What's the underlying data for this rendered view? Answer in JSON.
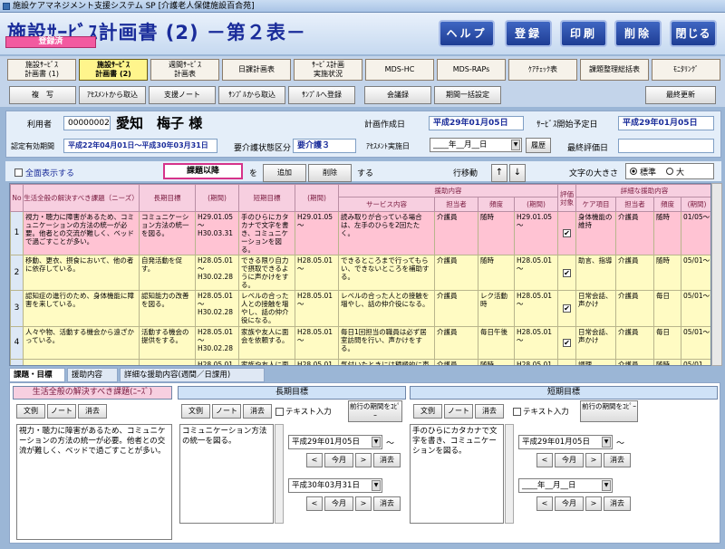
{
  "window": {
    "title": "施設ケアマネジメント支援システム SP [介護老人保健施設百合苑]"
  },
  "header": {
    "title": "施設ｻｰﾋﾞｽ計画書 (2) －第２表－",
    "status_badge": "登録済",
    "buttons": [
      "ヘルプ",
      "登録",
      "印刷",
      "削除",
      "閉じる"
    ]
  },
  "tabs": [
    [
      "施設ｻｰﾋﾞｽ",
      "計画書 (1)"
    ],
    [
      "施設ｻｰﾋﾞｽ",
      "計画書 (2)"
    ],
    [
      "週間ｻｰﾋﾞｽ",
      "計画表"
    ],
    [
      "日課計画表"
    ],
    [
      "ｻｰﾋﾞｽ計画",
      "実施状況"
    ],
    [
      "MDS-HC"
    ],
    [
      "MDS-RAPs"
    ],
    [
      "ｹｱﾁｪｯｸ表"
    ],
    [
      "課題整理総括表"
    ],
    [
      "ﾓﾆﾀﾘﾝｸﾞ"
    ]
  ],
  "actions": [
    "複　写",
    "ｱｾｽﾒﾝﾄから取込",
    "支援ノート",
    "ｻﾝﾌﾟﾙから取込",
    "ｻﾝﾌﾟﾙへ登録",
    "会議録",
    "期間一括設定",
    "最終更新"
  ],
  "info": {
    "user_label": "利用者",
    "user_id": "00000002",
    "user_name": "愛知　梅子 様",
    "created_label": "計画作成日",
    "created_date": "平成29年01月05日",
    "service_start_label": "ｻｰﾋﾞｽ開始予定日",
    "service_start_date": "平成29年01月05日",
    "cert_label": "認定有効期間",
    "cert_period": "平成22年04月01日～平成30年03月31日",
    "care_level_label": "要介護状態区分",
    "care_level": "要介護３",
    "assess_label": "ｱｾｽﾒﾝﾄ実施日",
    "assess_date": "____年__月__日",
    "history_btn": "履歴",
    "last_eval_label": "最終評価日"
  },
  "controls": {
    "show_all": "全面表示する",
    "issue_btn": "課題以降",
    "wo": "を",
    "add": "追加",
    "delete": "削除",
    "suru": "する",
    "row_move": "行移動",
    "up": "↑",
    "down": "↓",
    "font_size_label": "文字の大きさ",
    "font_std": "標準",
    "font_large": "大"
  },
  "table": {
    "headers": {
      "no": "No",
      "issue": "生活全般の解決すべき課題（ニーズ）",
      "long": "長期目標",
      "period": "(期間)",
      "short": "短期目標",
      "support": "援助内容",
      "service": "サービス内容",
      "staff": "担当者",
      "freq": "頻度",
      "eval": "評価対象",
      "detail": "詳細な援助内容",
      "care_item": "ケア項目"
    },
    "rows": [
      {
        "no": "1",
        "issue": "視力・聴力に障害があるため、コミュニケーションの方法の統一が必要。他者との交流が難しく、ベッドで過ごすことが多い。",
        "long": "コミュニケーション方法の統一を図る。",
        "lperiod": "H29.01.05～ H30.03.31",
        "short": "手のひらにカタカナで文字を書き、コミュニケーションを図る。",
        "speriod": "H29.01.05～",
        "service": "読み取りが合っている場合は、左手のひらを2回たたく。",
        "staff": "介護員",
        "freq": "随時",
        "period2": "H29.01.05～",
        "eval": "✔",
        "care": "身体機能の維持",
        "staff2": "介護員",
        "freq2": "随時",
        "p3": "01/05～"
      },
      {
        "no": "2",
        "issue": "移動、更衣、摂食において、他の者に依存している。",
        "long": "自発活動を促す。",
        "lperiod": "H28.05.01～ H30.02.28",
        "short": "できる限り自力で摂取できるように声かけをする。",
        "speriod": "H28.05.01～",
        "service": "できるところまで行ってもらい、できないところを補助する。",
        "staff": "介護員",
        "freq": "随時",
        "period2": "H28.05.01～",
        "eval": "✔",
        "care": "助言、指導",
        "staff2": "介護員",
        "freq2": "随時",
        "p3": "05/01～"
      },
      {
        "no": "3",
        "issue": "認知症の進行のため、身体機能に障害を来している。",
        "long": "認知能力の改善を図る。",
        "lperiod": "H28.05.01～ H30.02.28",
        "short": "レベルの合った人との接触を増やし、話の仲介役になる。",
        "speriod": "H28.05.01～",
        "service": "レベルの合った人との接触を増やし、話の仲介役になる。",
        "staff": "介護員",
        "freq": "レク活動時",
        "period2": "H28.05.01～",
        "eval": "✔",
        "care": "日常会話、声かけ",
        "staff2": "介護員",
        "freq2": "毎日",
        "p3": "05/01～"
      },
      {
        "no": "4",
        "issue": "人々や物、活動する機会から遠ざかっている。",
        "long": "活動する機会の提供をする。",
        "lperiod": "H28.05.01～ H30.02.28",
        "short": "家族や友人に面会を依頼する。",
        "speriod": "H28.05.01～",
        "service": "毎日1回担当の職員は必ず居室訪問を行い、声かけをする。",
        "staff": "介護員",
        "freq": "毎日午後",
        "period2": "H28.05.01～",
        "eval": "✔",
        "care": "日常会話、声かけ",
        "staff2": "介護員",
        "freq2": "毎日",
        "p3": "05/01～"
      },
      {
        "no": "",
        "issue": "",
        "long": "",
        "lperiod": "H28.05.01～",
        "short": "家族や友人に面会",
        "speriod": "H28.05.01～",
        "service": "気付いたときには積極的に声掛",
        "staff": "介護員",
        "freq": "随時",
        "period2": "H28.05.01～",
        "eval": "",
        "care": "調理",
        "staff2": "介護員",
        "freq2": "随時",
        "p3": "05/01"
      }
    ]
  },
  "subtabs": [
    "課題・目標",
    "援助内容",
    "詳細な援助内容(週間／日課用)"
  ],
  "bottom": {
    "issue_head": "生活全般の解決すべき課題(ﾆｰｽﾞ)",
    "long_head": "長期目標",
    "short_head": "短期目標",
    "bunrei": "文例",
    "note": "ノート",
    "clear": "消去",
    "text_input": "テキスト入力",
    "prev_period": "前行の期間をｺﾋﾟｰ",
    "issue_text": "視力・聴力に障害があるため、コミュニケーションの方法の統一が必要。他者との交流が難しく、ベッドで過ごすことが多い。",
    "long_text": "コミュニケーション方法の統一を図る。",
    "short_text": "手のひらにカタカナで文字を書き、コミュニケーションを図る。",
    "long_from": "平成29年01月05日",
    "long_to": "平成30年03月31日",
    "short_from": "平成29年01月05日",
    "short_to": "____年__月__日",
    "prev": "<",
    "today": "今月",
    "next": ">",
    "tilde": "～"
  }
}
